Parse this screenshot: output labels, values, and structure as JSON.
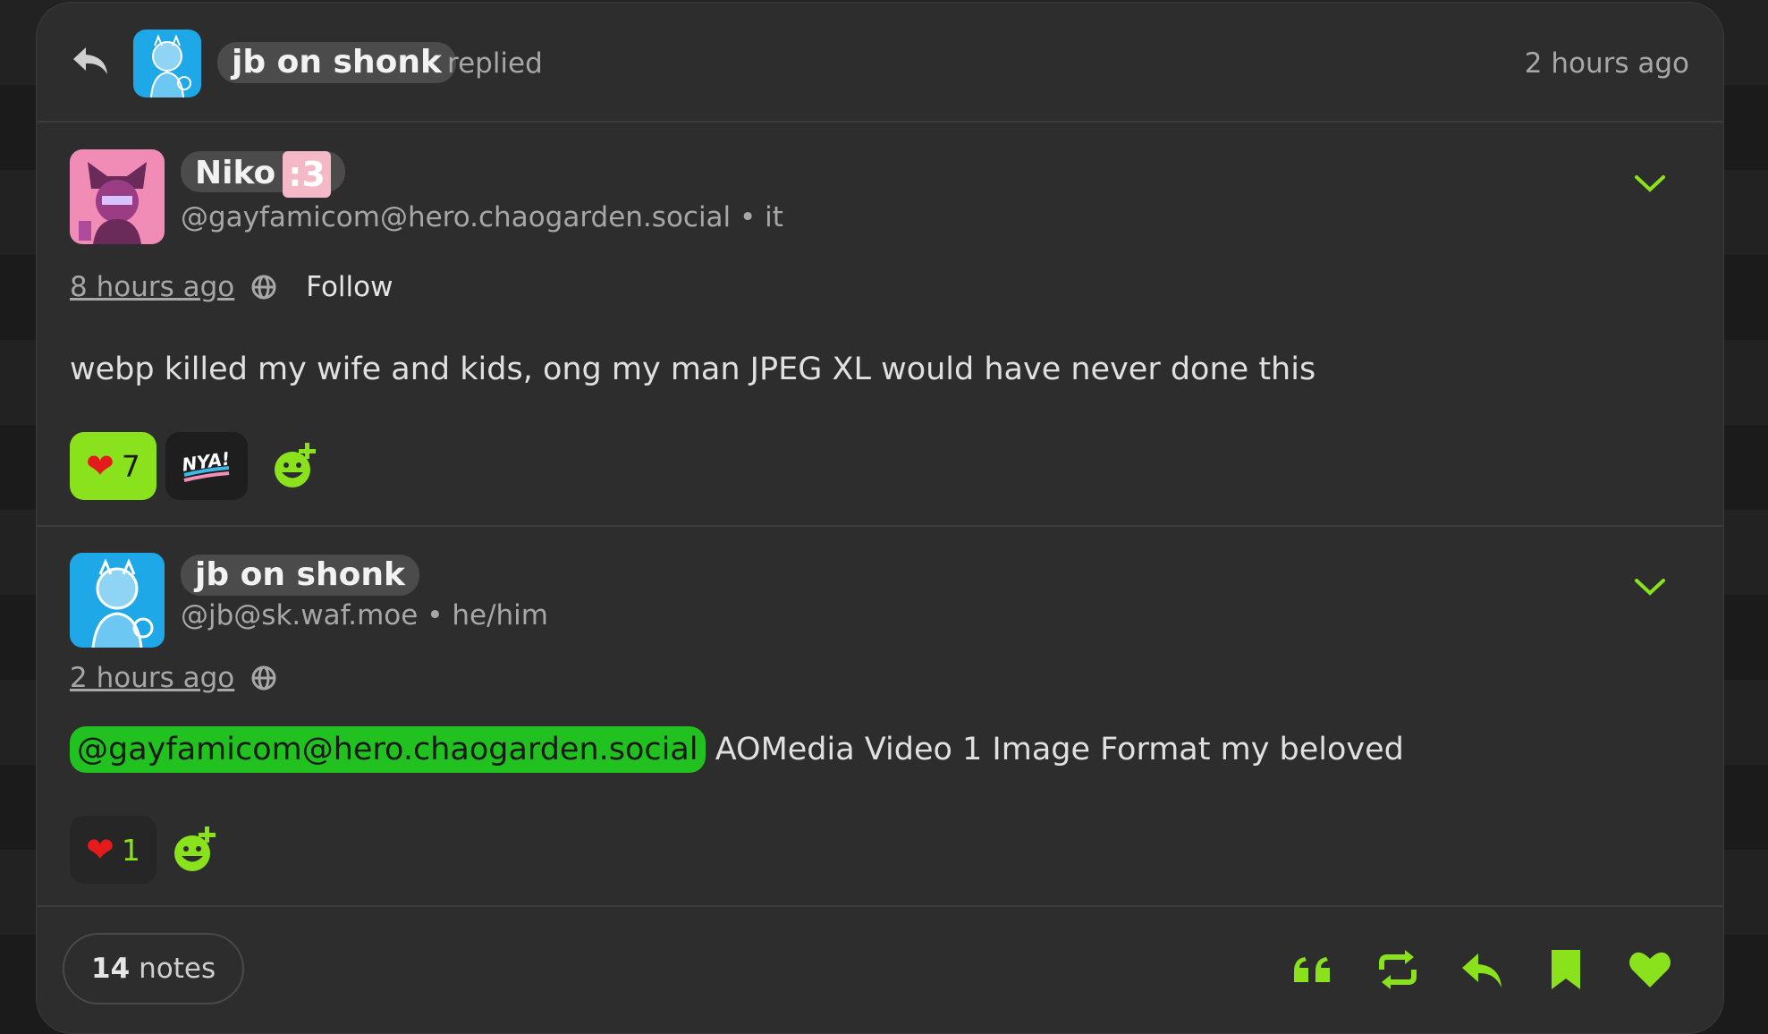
{
  "header": {
    "actor_name": "jb on shonk",
    "action": "replied",
    "time": "2 hours ago"
  },
  "notes": [
    {
      "display_name": "Niko",
      "name_emoji": ":3",
      "handle": "@gayfamicom@hero.chaogarden.social",
      "pronouns": "it",
      "time": "8 hours ago",
      "follow_label": "Follow",
      "body": "webp killed my wife and kids, ong my man JPEG XL would have never done this",
      "reactions": [
        {
          "emoji": "heart",
          "count": "7",
          "active": true
        },
        {
          "emoji": "NYA!",
          "count": ""
        }
      ]
    },
    {
      "display_name": "jb on shonk",
      "handle": "@jb@sk.waf.moe",
      "pronouns": "he/him",
      "time": "2 hours ago",
      "mention": "@gayfamicom@hero.chaogarden.social",
      "body": "AOMedia Video 1 Image Format my beloved",
      "reactions": [
        {
          "emoji": "heart",
          "count": "1",
          "active": false
        }
      ]
    }
  ],
  "footer": {
    "notes_count": "14",
    "notes_label": "notes",
    "actions": [
      "quote-icon",
      "repost-icon",
      "reply-icon",
      "bookmark-icon",
      "like-icon"
    ]
  },
  "colors": {
    "accent": "#8ae21d",
    "mention_bg": "#21c11f",
    "card_bg": "#2d2d2d",
    "page_bg": "#1b1b1b"
  }
}
